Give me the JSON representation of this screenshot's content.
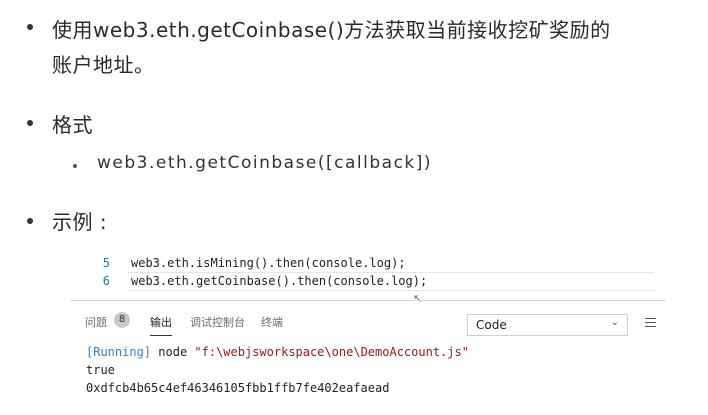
{
  "bullets": {
    "item1_line1": "使用web3.eth.getCoinbase()方法获取当前接收挖矿奖励的",
    "item1_line2": "账户地址。",
    "item2": "格式",
    "item2_sub": "web3.eth.getCoinbase([callback])",
    "item3": "示例 :"
  },
  "editor": {
    "lines": [
      {
        "number": "5",
        "code": "web3.eth.isMining().then(console.log);"
      },
      {
        "number": "6",
        "code": "web3.eth.getCoinbase().then(console.log);"
      }
    ]
  },
  "panel": {
    "tabs": [
      {
        "label": "问题"
      },
      {
        "label": "输出"
      },
      {
        "label": "调试控制台"
      },
      {
        "label": "终端"
      }
    ],
    "problems_count": "8",
    "dropdown_value": "Code",
    "output": {
      "running_tag": "[Running]",
      "command": "node",
      "path": "\"f:\\webjsworkspace\\one\\DemoAccount.js\"",
      "line2": "true",
      "line3": "0xdfcb4b65c4ef46346105fbb1ffb7fe402eafaead"
    }
  }
}
